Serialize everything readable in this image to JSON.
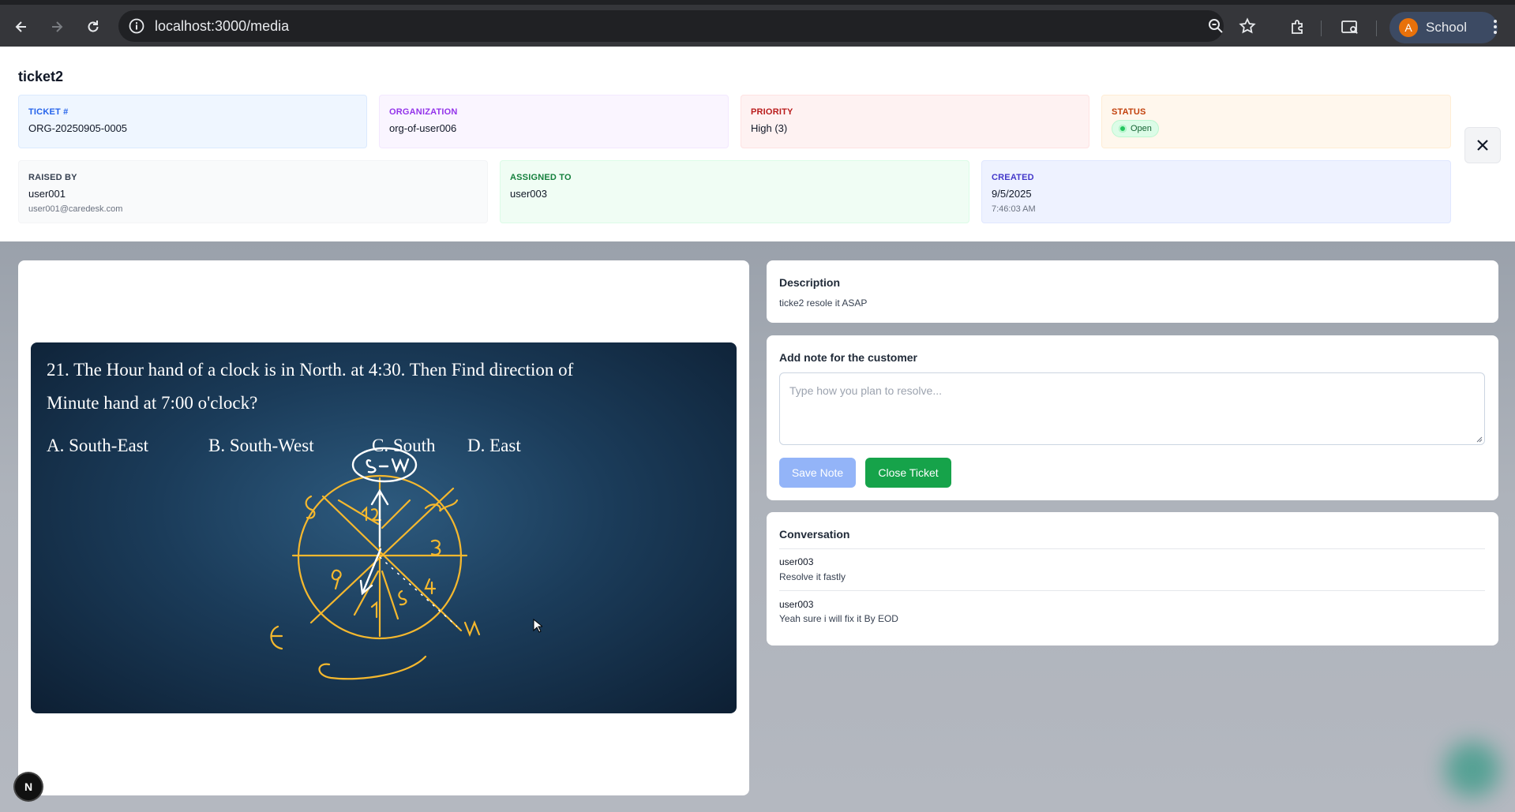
{
  "browser": {
    "url": "localhost:3000/media",
    "profile_initial": "A",
    "profile_label": "School"
  },
  "ticket": {
    "title": "ticket2",
    "fields": {
      "ticket_no": {
        "label": "TICKET #",
        "value": "ORG-20250905-0005"
      },
      "organization": {
        "label": "ORGANIZATION",
        "value": "org-of-user006"
      },
      "priority": {
        "label": "PRIORITY",
        "value": "High (3)"
      },
      "status": {
        "label": "STATUS",
        "value": "Open"
      },
      "raised_by": {
        "label": "RAISED BY",
        "value": "user001",
        "email": "user001@caredesk.com"
      },
      "assigned_to": {
        "label": "ASSIGNED TO",
        "value": "user003"
      },
      "created": {
        "label": "CREATED",
        "date": "9/5/2025",
        "time": "7:46:03 AM"
      }
    }
  },
  "media": {
    "question_line1": "21. The Hour hand of a clock is in North. at 4:30. Then Find direction of",
    "question_line2": "Minute hand at 7:00 o'clock?",
    "options": [
      "A. South-East",
      "B. South-West",
      "C. South",
      "D. East"
    ],
    "badge": "N"
  },
  "description": {
    "title": "Description",
    "text": "ticke2 resole it ASAP"
  },
  "note": {
    "title": "Add note for the customer",
    "placeholder": "Type how you plan to resolve...",
    "save_label": "Save Note",
    "close_label": "Close Ticket"
  },
  "conversation": {
    "title": "Conversation",
    "messages": [
      {
        "author": "user003",
        "text": "Resolve it fastly"
      },
      {
        "author": "user003",
        "text": "Yeah sure i will fix it By EOD"
      }
    ]
  },
  "colors": {
    "primary_disabled": "#93b4f8",
    "success": "#16a34a",
    "sketch": "#f5b82e"
  }
}
